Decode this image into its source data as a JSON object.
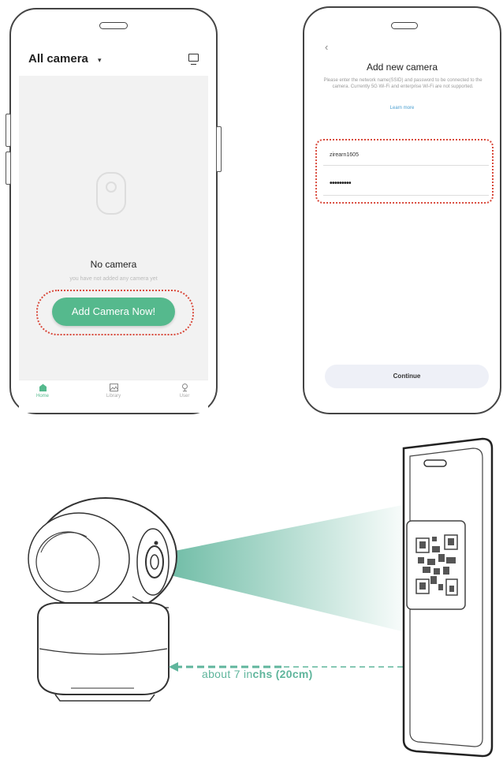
{
  "phone1": {
    "header": {
      "title": "All camera",
      "caret": "▾"
    },
    "empty": {
      "heading": "No camera",
      "subtext": "you have not added any camera yet"
    },
    "add_button_label": "Add Camera Now!",
    "tabs": [
      {
        "label": "Home",
        "icon": "home-icon",
        "active": true
      },
      {
        "label": "Library",
        "icon": "image-icon",
        "active": false
      },
      {
        "label": "User",
        "icon": "user-icon",
        "active": false
      }
    ]
  },
  "phone2": {
    "back": "‹",
    "title": "Add new camera",
    "description": "Please enter the network name(SSID) and password to be connected to the camera. Currently 5G Wi-Fi and enterprise Wi-Fi are not supported.",
    "learn_more": "Learn more",
    "ssid_value": "zirearn1605",
    "password_value": "•••••••••",
    "continue_label": "Continue"
  },
  "illustration": {
    "distance_prefix": "about 7 in",
    "distance_bold": "chs (20cm)"
  },
  "colors": {
    "accent": "#55b98d",
    "highlight_border": "#d94a3c",
    "link": "#4a9fd0",
    "beam": "#5fb59c"
  }
}
